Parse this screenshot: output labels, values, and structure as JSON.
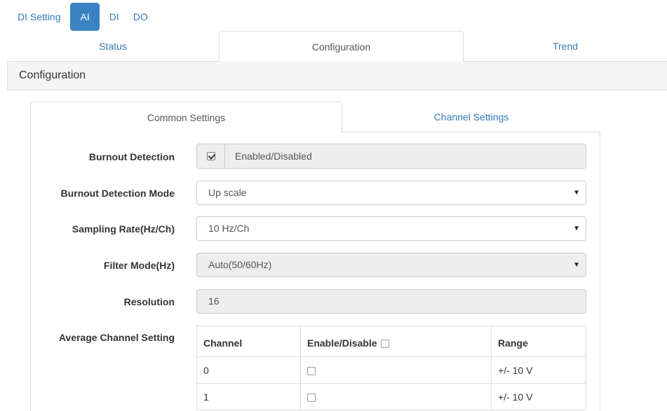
{
  "top_nav": {
    "items": [
      {
        "label": "DI Setting",
        "active": false
      },
      {
        "label": "AI",
        "active": true
      },
      {
        "label": "DI",
        "active": false
      },
      {
        "label": "DO",
        "active": false
      }
    ]
  },
  "main_tabs": [
    {
      "label": "Status",
      "active": false
    },
    {
      "label": "Configuration",
      "active": true
    },
    {
      "label": "Trend",
      "active": false
    }
  ],
  "panel": {
    "title": "Configuration"
  },
  "sub_tabs": [
    {
      "label": "Common Settings",
      "active": true
    },
    {
      "label": "Channel Settings",
      "active": false
    }
  ],
  "form": {
    "burnout_detection": {
      "label": "Burnout Detection",
      "checkbox_text": "Enabled/Disabled",
      "checked": true
    },
    "burnout_mode": {
      "label": "Burnout Detection Mode",
      "value": "Up scale"
    },
    "sampling_rate": {
      "label": "Sampling Rate(Hz/Ch)",
      "value": "10 Hz/Ch"
    },
    "filter_mode": {
      "label": "Filter Mode(Hz)",
      "value": "Auto(50/60Hz)"
    },
    "resolution": {
      "label": "Resolution",
      "value": "16"
    },
    "average_channel": {
      "label": "Average Channel Setting",
      "columns": [
        "Channel",
        "Enable/Disable",
        "Range"
      ],
      "rows": [
        {
          "channel": "0",
          "enabled": false,
          "range": "+/- 10 V"
        },
        {
          "channel": "1",
          "enabled": false,
          "range": "+/- 10 V"
        }
      ]
    }
  },
  "colors": {
    "accent": "#3a82c4",
    "link": "#337ab7"
  }
}
